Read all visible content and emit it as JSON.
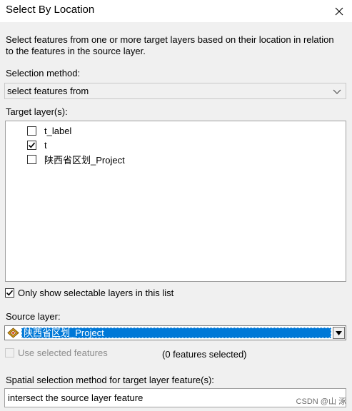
{
  "window": {
    "title": "Select By Location"
  },
  "description": "Select features from one or more target layers based on their location in relation to the features in the source layer.",
  "selection_method": {
    "label": "Selection method:",
    "value": "select features from"
  },
  "target_layers": {
    "label": "Target layer(s):",
    "items": [
      {
        "name": "t_label",
        "checked": false
      },
      {
        "name": "t",
        "checked": true
      },
      {
        "name": "陕西省区划_Project",
        "checked": false
      }
    ]
  },
  "only_selectable": {
    "label": "Only show selectable layers in this list",
    "checked": true
  },
  "source_layer": {
    "label": "Source layer:",
    "value": "陕西省区划_Project",
    "icon": "polygon-layer-icon"
  },
  "use_selected": {
    "label": "Use selected features",
    "checked": false,
    "enabled": false
  },
  "features_selected": "(0 features selected)",
  "spatial_method": {
    "label": "Spatial selection method for target layer feature(s):",
    "value": "intersect the source layer feature"
  },
  "watermark": "CSDN @山 涿",
  "colors": {
    "selection": "#0078d7",
    "dialog_bg": "#f0f0f0"
  }
}
